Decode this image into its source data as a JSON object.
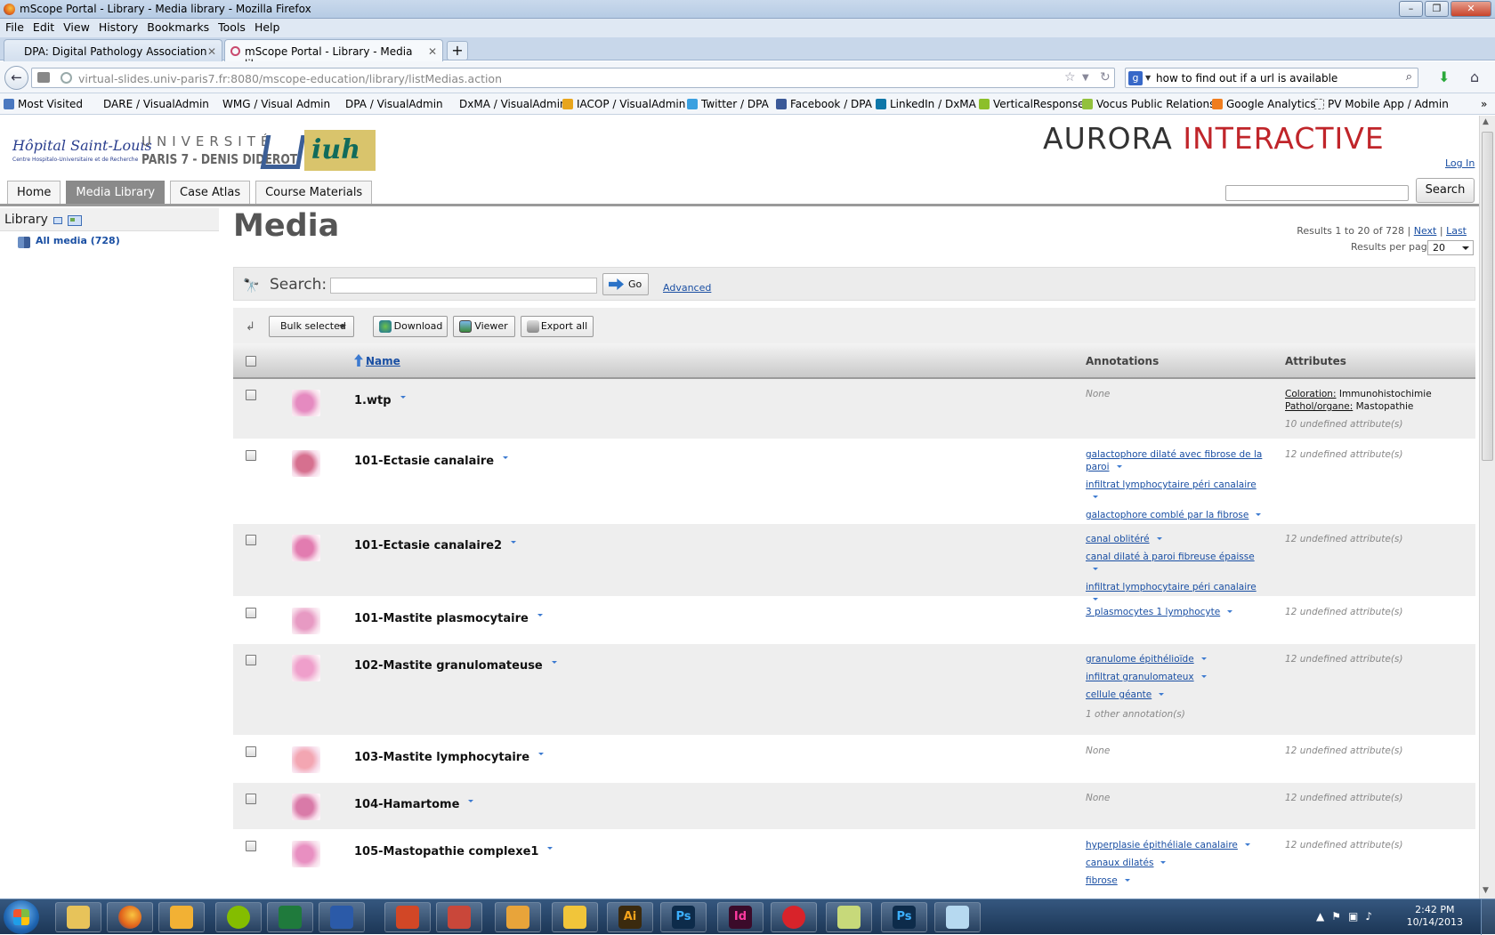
{
  "window": {
    "title": "mScope Portal - Library - Media library - Mozilla Firefox"
  },
  "menubar": [
    "File",
    "Edit",
    "View",
    "History",
    "Bookmarks",
    "Tools",
    "Help"
  ],
  "tabs": [
    {
      "label": "DPA: Digital Pathology Association"
    },
    {
      "label": "mScope Portal - Library - Media library"
    }
  ],
  "navbar": {
    "url": "virtual-slides.univ-paris7.fr:8080/mscope-education/library/listMedias.action",
    "search_query": "how to find out if a url is available",
    "search_engine_letter": "g"
  },
  "bookmarks": [
    "Most Visited",
    "DARE / VisualAdmin",
    "WMG / Visual Admin",
    "DPA / VisualAdmin",
    "DxMA / VisualAdmin",
    "IACOP / VisualAdmin",
    "Twitter / DPA",
    "Facebook / DPA",
    "LinkedIn / DxMA",
    "VerticalResponse",
    "Vocus Public Relations",
    "Google Analytics",
    "PV Mobile App / Admin"
  ],
  "header": {
    "hospital_name": "Hôpital Saint-Louis",
    "hospital_sub": "Centre Hospitalo-Universitaire et de Recherche",
    "univ_line1": "UNIVERSITÉ",
    "univ_line2": "PARIS 7 - DENIS DIDEROT",
    "iuh": "iuh",
    "aurora_1": "AURORA",
    "aurora_2": "INTERACTIVE",
    "login": "Log In",
    "search_button": "Search"
  },
  "page_tabs": [
    "Home",
    "Media Library",
    "Case Atlas",
    "Course Materials"
  ],
  "sidebar": {
    "title": "Library",
    "all_media": "All media (728)"
  },
  "main": {
    "title": "Media",
    "results": "Results 1 to 20 of 728",
    "next": "Next",
    "last": "Last",
    "results_per_page_label": "Results per page",
    "results_per_page": "20",
    "search_label": "Search:",
    "go": "Go",
    "advanced": "Advanced",
    "bulk_selected": "Bulk selected",
    "download": "Download",
    "viewer": "Viewer",
    "export_all": "Export all",
    "col_name": "Name",
    "col_annotations": "Annotations",
    "col_attributes": "Attributes"
  },
  "rows": [
    {
      "name": "1.wtp",
      "annotations": [],
      "none": "None",
      "attr_lines": [
        {
          "k": "Coloration:",
          "v": "Immunohistochimie"
        },
        {
          "k": "Pathol/organe:",
          "v": "Mastopathie"
        }
      ],
      "undefined": "10 undefined attribute(s)",
      "thumb": "#e58ac0"
    },
    {
      "name": "101-Ectasie canalaire",
      "annotations": [
        "galactophore dilaté avec fibrose de la paroi",
        "infiltrat lymphocytaire péri canalaire",
        "galactophore comblé par la fibrose"
      ],
      "undefined": "12 undefined attribute(s)",
      "thumb": "#d6708f"
    },
    {
      "name": "101-Ectasie canalaire2",
      "annotations": [
        "canal oblitéré",
        "canal dilaté à paroi fibreuse épaisse",
        "infiltrat lymphocytaire péri canalaire"
      ],
      "undefined": "12 undefined attribute(s)",
      "thumb": "#e27cb0"
    },
    {
      "name": "101-Mastite plasmocytaire",
      "annotations": [
        "3 plasmocytes 1 lymphocyte"
      ],
      "undefined": "12 undefined attribute(s)",
      "thumb": "#e79ac3"
    },
    {
      "name": "102-Mastite granulomateuse",
      "annotations": [
        "granulome épithélioïde",
        "infiltrat granulomateux",
        "cellule géante"
      ],
      "other": "1 other annotation(s)",
      "undefined": "12 undefined attribute(s)",
      "thumb": "#ef9fcb"
    },
    {
      "name": "103-Mastite lymphocytaire",
      "annotations": [],
      "none": "None",
      "undefined": "12 undefined attribute(s)",
      "thumb": "#f3a6b2"
    },
    {
      "name": "104-Hamartome",
      "annotations": [],
      "none": "None",
      "undefined": "12 undefined attribute(s)",
      "thumb": "#d97aa8"
    },
    {
      "name": "105-Mastopathie complexe1",
      "annotations": [
        "hyperplasie épithéliale canalaire",
        "canaux dilatés",
        "fibrose"
      ],
      "undefined": "12 undefined attribute(s)",
      "thumb": "#e88fc1"
    }
  ],
  "taskbar": {
    "time": "2:42 PM",
    "date": "10/14/2013"
  }
}
